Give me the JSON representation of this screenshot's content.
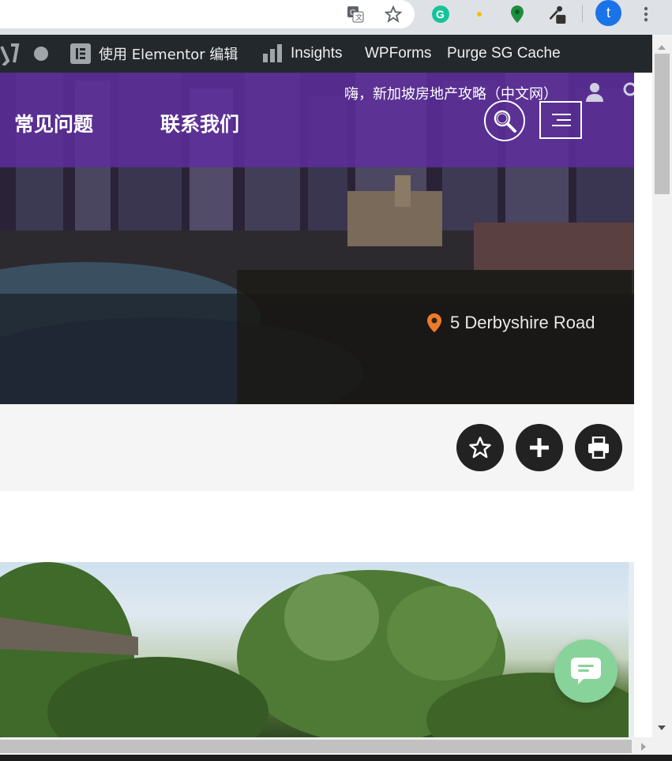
{
  "browser": {
    "avatar_letter": "t",
    "icons": [
      "translate-icon",
      "bookmark-star-icon",
      "grammarly-icon",
      "extension-dot-icon",
      "map-pin-extension-icon",
      "eyedropper-icon",
      "more-vert-icon"
    ]
  },
  "admin_bar": {
    "elementor_label": "使用 Elementor 编辑",
    "insights_label": "Insights",
    "wpforms_label": "WPForms",
    "purge_label": "Purge SG Cache"
  },
  "header": {
    "greeting": "嗨，新加坡房地产攻略（中文网）",
    "nav": [
      "常见问题",
      "联系我们"
    ]
  },
  "hero": {
    "address": "5 Derbyshire Road",
    "pin_color": "#f07b27"
  },
  "actions": {
    "icons": [
      "star-outline-icon",
      "plus-icon",
      "print-icon"
    ]
  },
  "colors": {
    "header_purple": "#5f2da0",
    "admin_bar": "#23282d",
    "chat_green": "#88d39a"
  }
}
